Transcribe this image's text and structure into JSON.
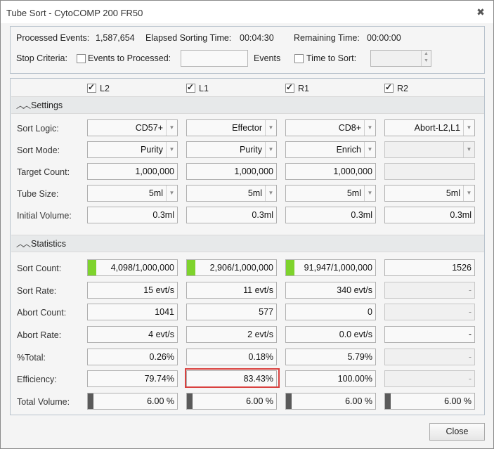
{
  "window": {
    "title": "Tube Sort - CytoCOMP 200 FR50"
  },
  "header": {
    "processed_label": "Processed Events:",
    "processed_value": "1,587,654",
    "elapsed_label": "Elapsed Sorting Time:",
    "elapsed_value": "00:04:30",
    "remaining_label": "Remaining Time:",
    "remaining_value": "00:00:00",
    "stop_criteria_label": "Stop Criteria:",
    "events_to_process_label": "Events to Processed:",
    "events_to_process_checked": false,
    "events_to_process_value": "",
    "events_unit": "Events",
    "time_to_sort_label": "Time to Sort:",
    "time_to_sort_checked": false,
    "time_to_sort_value": ""
  },
  "tubes": [
    {
      "label": "L2",
      "checked": true
    },
    {
      "label": "L1",
      "checked": true
    },
    {
      "label": "R1",
      "checked": true
    },
    {
      "label": "R2",
      "checked": true
    }
  ],
  "settings": {
    "title": "Settings",
    "sort_logic_label": "Sort Logic:",
    "sort_logic": [
      "CD57+",
      "Effector",
      "CD8+",
      "Abort-L2,L1"
    ],
    "sort_mode_label": "Sort Mode:",
    "sort_mode": [
      "Purity",
      "Purity",
      "Enrich",
      ""
    ],
    "target_count_label": "Target Count:",
    "target_count": [
      "1,000,000",
      "1,000,000",
      "1,000,000",
      ""
    ],
    "tube_size_label": "Tube Size:",
    "tube_size": [
      "5ml",
      "5ml",
      "5ml",
      "5ml"
    ],
    "initial_volume_label": "Initial Volume:",
    "initial_volume": [
      "0.3ml",
      "0.3ml",
      "0.3ml",
      "0.3ml"
    ]
  },
  "statistics": {
    "title": "Statistics",
    "sort_count_label": "Sort Count:",
    "sort_count": [
      "4,098/1,000,000",
      "2,906/1,000,000",
      "91,947/1,000,000",
      "1526"
    ],
    "sort_count_progress": [
      0.004,
      0.003,
      0.092,
      0
    ],
    "sort_rate_label": "Sort Rate:",
    "sort_rate": [
      "15 evt/s",
      "11 evt/s",
      "340 evt/s",
      "-"
    ],
    "abort_count_label": "Abort Count:",
    "abort_count": [
      "1041",
      "577",
      "0",
      "-"
    ],
    "abort_rate_label": "Abort Rate:",
    "abort_rate": [
      "4 evt/s",
      "2 evt/s",
      "0.0 evt/s",
      "-"
    ],
    "total_pct_label": "%Total:",
    "total_pct": [
      "0.26%",
      "0.18%",
      "5.79%",
      "-"
    ],
    "efficiency_label": "Efficiency:",
    "efficiency": [
      "79.74%",
      "83.43%",
      "100.00%",
      "-"
    ],
    "total_volume_label": "Total Volume:",
    "total_volume": [
      "6.00 %",
      "6.00 %",
      "6.00 %",
      "6.00 %"
    ],
    "total_volume_fraction": [
      0.06,
      0.06,
      0.06,
      0.06
    ]
  },
  "footer": {
    "close_label": "Close"
  },
  "colors": {
    "progress_green": "#7ed32c",
    "volume_bar": "#5a5a5a",
    "highlight": "#d9413f"
  }
}
